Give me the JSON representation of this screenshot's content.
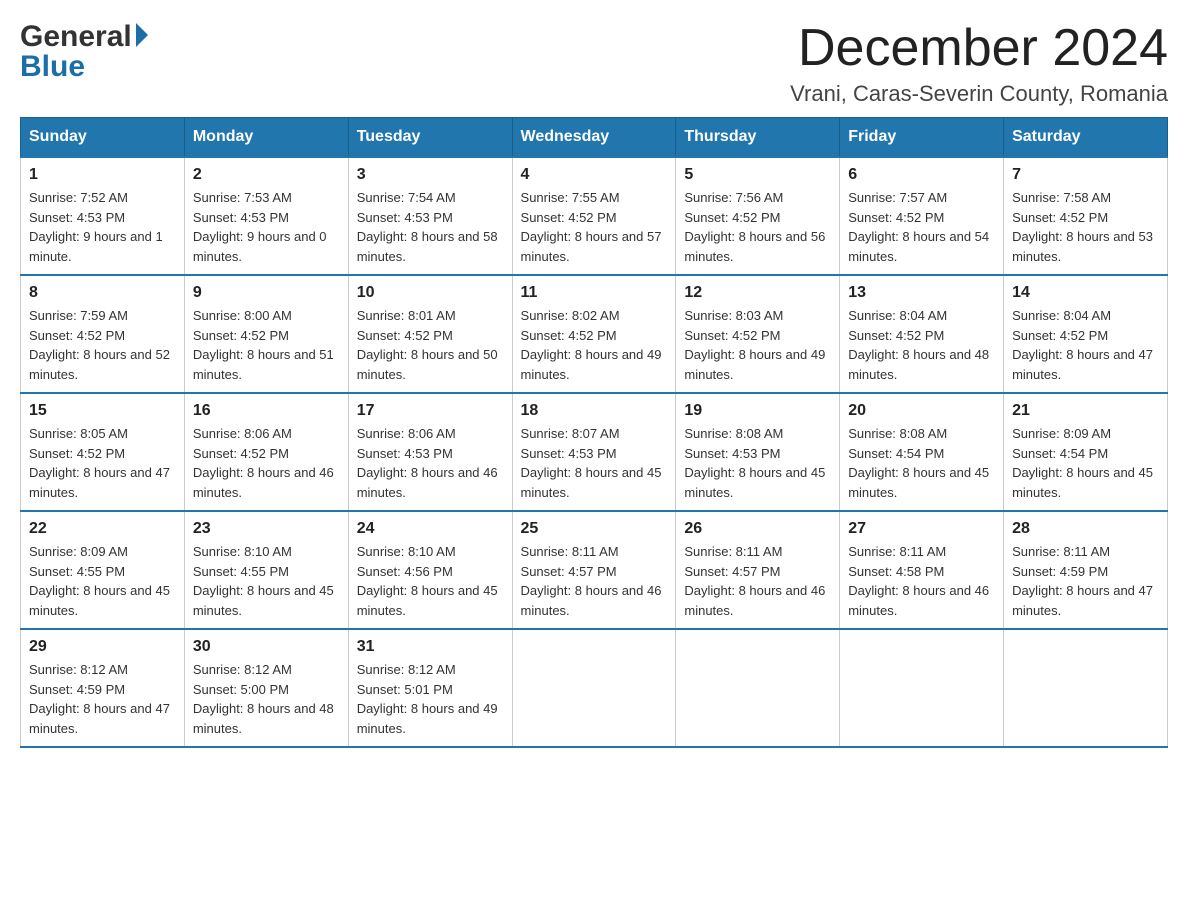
{
  "header": {
    "logo_general": "General",
    "logo_blue": "Blue",
    "month_title": "December 2024",
    "location": "Vrani, Caras-Severin County, Romania"
  },
  "days_of_week": [
    "Sunday",
    "Monday",
    "Tuesday",
    "Wednesday",
    "Thursday",
    "Friday",
    "Saturday"
  ],
  "weeks": [
    [
      {
        "day": "1",
        "sunrise": "Sunrise: 7:52 AM",
        "sunset": "Sunset: 4:53 PM",
        "daylight": "Daylight: 9 hours and 1 minute."
      },
      {
        "day": "2",
        "sunrise": "Sunrise: 7:53 AM",
        "sunset": "Sunset: 4:53 PM",
        "daylight": "Daylight: 9 hours and 0 minutes."
      },
      {
        "day": "3",
        "sunrise": "Sunrise: 7:54 AM",
        "sunset": "Sunset: 4:53 PM",
        "daylight": "Daylight: 8 hours and 58 minutes."
      },
      {
        "day": "4",
        "sunrise": "Sunrise: 7:55 AM",
        "sunset": "Sunset: 4:52 PM",
        "daylight": "Daylight: 8 hours and 57 minutes."
      },
      {
        "day": "5",
        "sunrise": "Sunrise: 7:56 AM",
        "sunset": "Sunset: 4:52 PM",
        "daylight": "Daylight: 8 hours and 56 minutes."
      },
      {
        "day": "6",
        "sunrise": "Sunrise: 7:57 AM",
        "sunset": "Sunset: 4:52 PM",
        "daylight": "Daylight: 8 hours and 54 minutes."
      },
      {
        "day": "7",
        "sunrise": "Sunrise: 7:58 AM",
        "sunset": "Sunset: 4:52 PM",
        "daylight": "Daylight: 8 hours and 53 minutes."
      }
    ],
    [
      {
        "day": "8",
        "sunrise": "Sunrise: 7:59 AM",
        "sunset": "Sunset: 4:52 PM",
        "daylight": "Daylight: 8 hours and 52 minutes."
      },
      {
        "day": "9",
        "sunrise": "Sunrise: 8:00 AM",
        "sunset": "Sunset: 4:52 PM",
        "daylight": "Daylight: 8 hours and 51 minutes."
      },
      {
        "day": "10",
        "sunrise": "Sunrise: 8:01 AM",
        "sunset": "Sunset: 4:52 PM",
        "daylight": "Daylight: 8 hours and 50 minutes."
      },
      {
        "day": "11",
        "sunrise": "Sunrise: 8:02 AM",
        "sunset": "Sunset: 4:52 PM",
        "daylight": "Daylight: 8 hours and 49 minutes."
      },
      {
        "day": "12",
        "sunrise": "Sunrise: 8:03 AM",
        "sunset": "Sunset: 4:52 PM",
        "daylight": "Daylight: 8 hours and 49 minutes."
      },
      {
        "day": "13",
        "sunrise": "Sunrise: 8:04 AM",
        "sunset": "Sunset: 4:52 PM",
        "daylight": "Daylight: 8 hours and 48 minutes."
      },
      {
        "day": "14",
        "sunrise": "Sunrise: 8:04 AM",
        "sunset": "Sunset: 4:52 PM",
        "daylight": "Daylight: 8 hours and 47 minutes."
      }
    ],
    [
      {
        "day": "15",
        "sunrise": "Sunrise: 8:05 AM",
        "sunset": "Sunset: 4:52 PM",
        "daylight": "Daylight: 8 hours and 47 minutes."
      },
      {
        "day": "16",
        "sunrise": "Sunrise: 8:06 AM",
        "sunset": "Sunset: 4:52 PM",
        "daylight": "Daylight: 8 hours and 46 minutes."
      },
      {
        "day": "17",
        "sunrise": "Sunrise: 8:06 AM",
        "sunset": "Sunset: 4:53 PM",
        "daylight": "Daylight: 8 hours and 46 minutes."
      },
      {
        "day": "18",
        "sunrise": "Sunrise: 8:07 AM",
        "sunset": "Sunset: 4:53 PM",
        "daylight": "Daylight: 8 hours and 45 minutes."
      },
      {
        "day": "19",
        "sunrise": "Sunrise: 8:08 AM",
        "sunset": "Sunset: 4:53 PM",
        "daylight": "Daylight: 8 hours and 45 minutes."
      },
      {
        "day": "20",
        "sunrise": "Sunrise: 8:08 AM",
        "sunset": "Sunset: 4:54 PM",
        "daylight": "Daylight: 8 hours and 45 minutes."
      },
      {
        "day": "21",
        "sunrise": "Sunrise: 8:09 AM",
        "sunset": "Sunset: 4:54 PM",
        "daylight": "Daylight: 8 hours and 45 minutes."
      }
    ],
    [
      {
        "day": "22",
        "sunrise": "Sunrise: 8:09 AM",
        "sunset": "Sunset: 4:55 PM",
        "daylight": "Daylight: 8 hours and 45 minutes."
      },
      {
        "day": "23",
        "sunrise": "Sunrise: 8:10 AM",
        "sunset": "Sunset: 4:55 PM",
        "daylight": "Daylight: 8 hours and 45 minutes."
      },
      {
        "day": "24",
        "sunrise": "Sunrise: 8:10 AM",
        "sunset": "Sunset: 4:56 PM",
        "daylight": "Daylight: 8 hours and 45 minutes."
      },
      {
        "day": "25",
        "sunrise": "Sunrise: 8:11 AM",
        "sunset": "Sunset: 4:57 PM",
        "daylight": "Daylight: 8 hours and 46 minutes."
      },
      {
        "day": "26",
        "sunrise": "Sunrise: 8:11 AM",
        "sunset": "Sunset: 4:57 PM",
        "daylight": "Daylight: 8 hours and 46 minutes."
      },
      {
        "day": "27",
        "sunrise": "Sunrise: 8:11 AM",
        "sunset": "Sunset: 4:58 PM",
        "daylight": "Daylight: 8 hours and 46 minutes."
      },
      {
        "day": "28",
        "sunrise": "Sunrise: 8:11 AM",
        "sunset": "Sunset: 4:59 PM",
        "daylight": "Daylight: 8 hours and 47 minutes."
      }
    ],
    [
      {
        "day": "29",
        "sunrise": "Sunrise: 8:12 AM",
        "sunset": "Sunset: 4:59 PM",
        "daylight": "Daylight: 8 hours and 47 minutes."
      },
      {
        "day": "30",
        "sunrise": "Sunrise: 8:12 AM",
        "sunset": "Sunset: 5:00 PM",
        "daylight": "Daylight: 8 hours and 48 minutes."
      },
      {
        "day": "31",
        "sunrise": "Sunrise: 8:12 AM",
        "sunset": "Sunset: 5:01 PM",
        "daylight": "Daylight: 8 hours and 49 minutes."
      },
      null,
      null,
      null,
      null
    ]
  ]
}
